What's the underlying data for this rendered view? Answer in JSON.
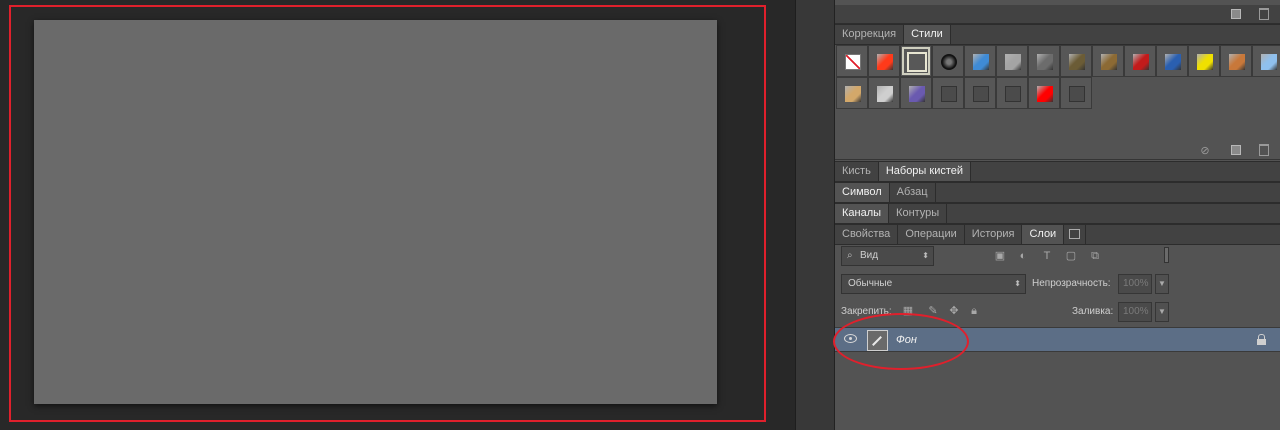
{
  "panels": {
    "styles_tabs": [
      "Коррекция",
      "Стили"
    ],
    "styles_active": 1,
    "swatches": [
      {
        "color": "#ffffff",
        "icon": "none-style-icon"
      },
      {
        "color": "#ff3a1a",
        "icon": "red-glow-style-icon"
      },
      {
        "color": "#575757",
        "icon": "frame-style-icon"
      },
      {
        "color": "#1e1e1e",
        "icon": "dark-button-style-icon"
      },
      {
        "color": "#3f8bd6",
        "icon": "blue-glass-style-icon"
      },
      {
        "color": "#a4a4a4",
        "icon": "gray-style-icon"
      },
      {
        "color": "#6c6c6c",
        "icon": "chrome-style-icon"
      },
      {
        "color": "#6b5c36",
        "icon": "olive-style-icon"
      },
      {
        "color": "#8c6a34",
        "icon": "bronze-style-icon"
      },
      {
        "color": "#c21b1b",
        "icon": "red-stripe-style-icon"
      },
      {
        "color": "#2a5fb0",
        "icon": "multicolor-style-icon"
      },
      {
        "color": "#f0e000",
        "icon": "yellow-style-icon"
      },
      {
        "color": "#c8783a",
        "icon": "copper-style-icon"
      },
      {
        "color": "#8fc0ee",
        "icon": "light-blue-style-icon"
      },
      {
        "color": "#d3a86a",
        "icon": "sunset-style-icon"
      },
      {
        "color": "#cfcfcf",
        "icon": "mosaic-style-icon"
      },
      {
        "color": "#6a5ab0",
        "icon": "purple-style-icon"
      },
      {
        "color": "#4b4b4b",
        "icon": "dark-gray-style-icon-1"
      },
      {
        "color": "#4b4b4b",
        "icon": "dark-gray-style-icon-2"
      },
      {
        "color": "#4b4b4b",
        "icon": "dark-gray-style-icon-3"
      },
      {
        "color": "#ff0000",
        "icon": "red-style-icon"
      },
      {
        "color": "#4b4b4b",
        "icon": "dark-gray-style-icon-4"
      }
    ],
    "brush_tabs": [
      "Кисть",
      "Наборы кистей"
    ],
    "brush_active": 1,
    "char_tabs": [
      "Символ",
      "Абзац"
    ],
    "char_active": 0,
    "channel_tabs": [
      "Каналы",
      "Контуры"
    ],
    "channel_active": 0,
    "layer_tabs": [
      "Свойства",
      "Операции",
      "История",
      "Слои"
    ],
    "layer_active": 3,
    "filter_kind": "Вид",
    "blend_mode": "Обычные",
    "opacity_label": "Непрозрачность:",
    "opacity_value": "100%",
    "lock_label": "Закрепить:",
    "fill_label": "Заливка:",
    "fill_value": "100%",
    "layer_name": "Фон"
  },
  "colors": {
    "annotation": "#e0202c",
    "canvas": "#6a6a6a",
    "selected_layer": "#5c6e86"
  }
}
